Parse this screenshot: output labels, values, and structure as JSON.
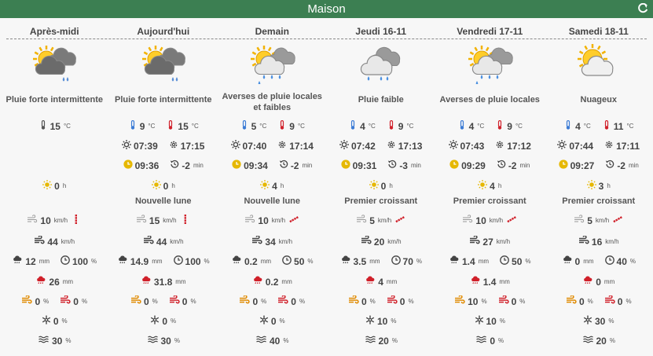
{
  "title": "Maison",
  "header_icon": "refresh-icon",
  "colors": {
    "header": "#3c7f52",
    "cold": "#3a7bd5",
    "hot": "#d0202a",
    "sun": "#e6b800",
    "orange": "#e08a00"
  },
  "days": [
    {
      "name": "Après-midi",
      "icon": "heavy-rain-sun",
      "condition": "Pluie forte intermittente",
      "mode": "single",
      "temp": "15",
      "temp_unit": "°C",
      "sunshine": "0",
      "sunshine_unit": "h",
      "moon": "",
      "wind": "10",
      "wind_unit": "km/h",
      "gust": "44",
      "gust_unit": "km/h",
      "rain": "12",
      "rain_unit": "mm",
      "rain_prob": "100",
      "rain_prob_unit": "%",
      "rain_heavy": "26",
      "rain_heavy_unit": "mm",
      "wind_o": "0",
      "wind_r": "0",
      "pct": "%",
      "snow": "0",
      "fog": "30"
    },
    {
      "name": "Aujourd'hui",
      "icon": "heavy-rain-sun",
      "condition": "Pluie forte intermittente",
      "mode": "pair",
      "tmin": "9",
      "tmax": "15",
      "temp_unit": "°C",
      "sunrise": "07:39",
      "sunset": "17:15",
      "daylen": "09:36",
      "daydiff": "-2",
      "min_unit": "min",
      "sunshine": "0",
      "sunshine_unit": "h",
      "moon": "Nouvelle lune",
      "wind": "15",
      "wind_unit": "km/h",
      "gust": "44",
      "gust_unit": "km/h",
      "rain": "14.9",
      "rain_unit": "mm",
      "rain_prob": "100",
      "rain_prob_unit": "%",
      "rain_heavy": "31.8",
      "rain_heavy_unit": "mm",
      "wind_o": "0",
      "wind_r": "0",
      "pct": "%",
      "snow": "0",
      "fog": "30"
    },
    {
      "name": "Demain",
      "icon": "showers-sun",
      "condition": "Averses de pluie locales et faibles",
      "mode": "pair",
      "tmin": "5",
      "tmax": "9",
      "temp_unit": "°C",
      "sunrise": "07:40",
      "sunset": "17:14",
      "daylen": "09:34",
      "daydiff": "-2",
      "min_unit": "min",
      "sunshine": "4",
      "sunshine_unit": "h",
      "moon": "Nouvelle lune",
      "wind": "10",
      "wind_unit": "km/h",
      "gust": "34",
      "gust_unit": "km/h",
      "rain": "0.2",
      "rain_unit": "mm",
      "rain_prob": "50",
      "rain_prob_unit": "%",
      "rain_heavy": "0.2",
      "rain_heavy_unit": "mm",
      "wind_o": "0",
      "wind_r": "0",
      "pct": "%",
      "snow": "0",
      "fog": "40"
    },
    {
      "name": "Jeudi 16-11",
      "icon": "light-rain",
      "condition": "Pluie faible",
      "mode": "pair",
      "tmin": "4",
      "tmax": "9",
      "temp_unit": "°C",
      "sunrise": "07:42",
      "sunset": "17:13",
      "daylen": "09:31",
      "daydiff": "-3",
      "min_unit": "min",
      "sunshine": "0",
      "sunshine_unit": "h",
      "moon": "Premier croissant",
      "wind": "5",
      "wind_unit": "km/h",
      "gust": "20",
      "gust_unit": "km/h",
      "rain": "3.5",
      "rain_unit": "mm",
      "rain_prob": "70",
      "rain_prob_unit": "%",
      "rain_heavy": "4",
      "rain_heavy_unit": "mm",
      "wind_o": "0",
      "wind_r": "0",
      "pct": "%",
      "snow": "10",
      "fog": "20"
    },
    {
      "name": "Vendredi 17-11",
      "icon": "showers-sun",
      "condition": "Averses de pluie locales",
      "mode": "pair",
      "tmin": "4",
      "tmax": "9",
      "temp_unit": "°C",
      "sunrise": "07:43",
      "sunset": "17:12",
      "daylen": "09:29",
      "daydiff": "-2",
      "min_unit": "min",
      "sunshine": "4",
      "sunshine_unit": "h",
      "moon": "Premier croissant",
      "wind": "10",
      "wind_unit": "km/h",
      "gust": "27",
      "gust_unit": "km/h",
      "rain": "1.4",
      "rain_unit": "mm",
      "rain_prob": "50",
      "rain_prob_unit": "%",
      "rain_heavy": "1.4",
      "rain_heavy_unit": "mm",
      "wind_o": "10",
      "wind_r": "0",
      "pct": "%",
      "snow": "10",
      "fog": "0"
    },
    {
      "name": "Samedi 18-11",
      "icon": "clouds-sun",
      "condition": "Nuageux",
      "mode": "pair",
      "tmin": "4",
      "tmax": "11",
      "temp_unit": "°C",
      "sunrise": "07:44",
      "sunset": "17:11",
      "daylen": "09:27",
      "daydiff": "-2",
      "min_unit": "min",
      "sunshine": "3",
      "sunshine_unit": "h",
      "moon": "Premier croissant",
      "wind": "5",
      "wind_unit": "km/h",
      "gust": "16",
      "gust_unit": "km/h",
      "rain": "0",
      "rain_unit": "mm",
      "rain_prob": "40",
      "rain_prob_unit": "%",
      "rain_heavy": "0",
      "rain_heavy_unit": "mm",
      "wind_o": "0",
      "wind_r": "0",
      "pct": "%",
      "snow": "30",
      "fog": "20"
    }
  ]
}
